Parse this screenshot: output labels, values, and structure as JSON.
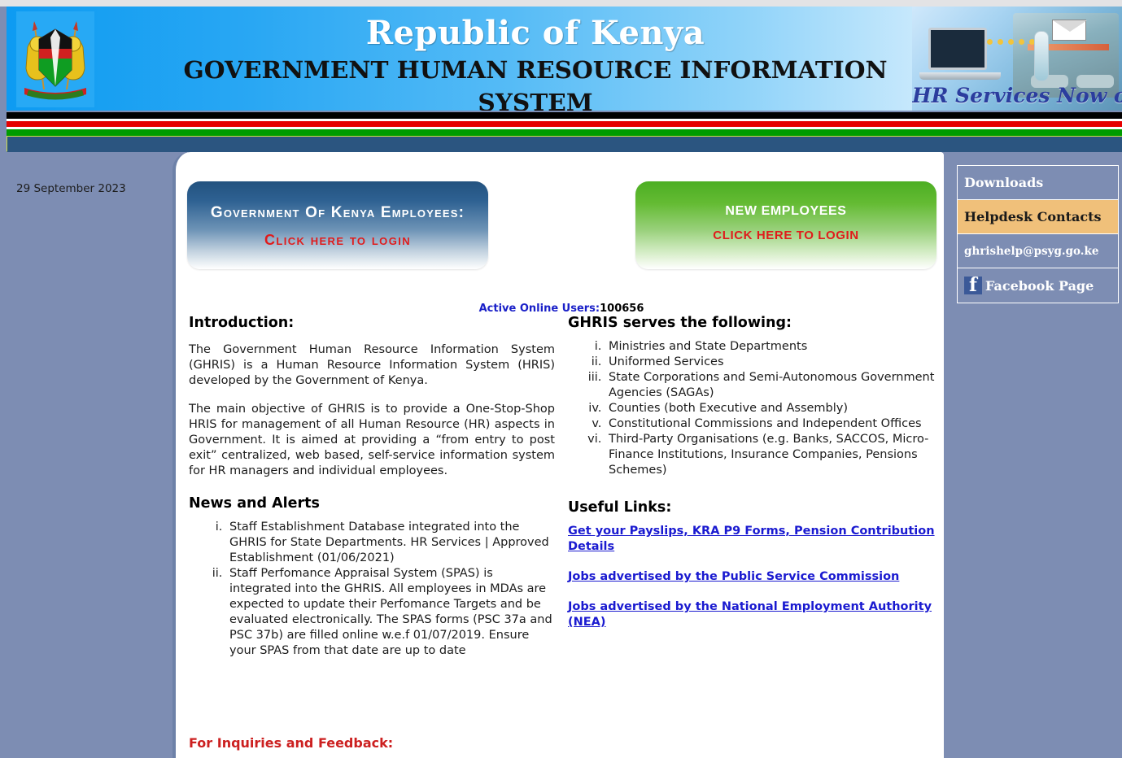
{
  "banner": {
    "emblem": "kenya-coat-of-arms",
    "title_line1": "Republic of Kenya",
    "title_line2": "GOVERNMENT HUMAN RESOURCE INFORMATION SYSTEM",
    "promo_caption": "HR Services Now online"
  },
  "date": "29 September 2023",
  "buttons": {
    "gok": {
      "line1": "Government Of Kenya Employees:",
      "line2": "Click here to login"
    },
    "new": {
      "line1": "NEW EMPLOYEES",
      "line2": "CLICK HERE TO LOGIN"
    }
  },
  "active_users": {
    "label": "Active Online Users:",
    "count": "100656"
  },
  "introduction": {
    "heading": "Introduction:",
    "paragraph1": "The Government Human Resource Information System (GHRIS) is a Human Resource Information System (HRIS) developed by the Government of Kenya.",
    "paragraph2": "The main objective of GHRIS is to provide a One-Stop-Shop HRIS for management of all Human Resource (HR) aspects in Government. It is aimed at providing a “from entry to post exit” centralized, web based, self-service information system for HR managers and individual employees."
  },
  "serves": {
    "heading": "GHRIS serves the following:",
    "items": [
      "Ministries and State Departments",
      "Uniformed Services",
      "State Corporations and Semi-Autonomous Government Agencies (SAGAs)",
      "Counties (both Executive and Assembly)",
      "Constitutional Commissions and Independent Offices",
      "Third-Party Organisations (e.g. Banks, SACCOS, Micro-Finance Institutions, Insurance Companies, Pensions Schemes)"
    ]
  },
  "news": {
    "heading": "News and Alerts",
    "items": [
      "Staff Establishment Database integrated into the GHRIS for State Departments. HR Services | Approved Establishment (01/06/2021)",
      "Staff Perfomance Appraisal System (SPAS) is integrated into the GHRIS. All employees in MDAs are expected to update their Perfomance Targets and be evaluated electronically. The SPAS forms (PSC 37a and PSC 37b) are filled online w.e.f 01/07/2019. Ensure your SPAS from that date are up to date"
    ]
  },
  "useful_links": {
    "heading": "Useful Links:",
    "links": [
      "Get your Payslips, KRA P9 Forms, Pension Contribution Details",
      "Jobs advertised by the Public Service Commission",
      "Jobs advertised by the National Employment Authority (NEA)"
    ]
  },
  "inquiries_heading": "For Inquiries and Feedback:",
  "sidebar": {
    "items": [
      {
        "label": "Downloads",
        "style": "plain"
      },
      {
        "label": "Helpdesk Contacts",
        "style": "highlight"
      },
      {
        "label": "ghrishelp@psyg.go.ke",
        "style": "small"
      },
      {
        "label": "Facebook Page",
        "style": "facebook",
        "icon": "facebook-icon"
      }
    ]
  },
  "colors": {
    "page_background": "#7d8db3",
    "navbar": "#2b5580",
    "flag_red": "#e60000",
    "flag_green": "#009c00",
    "flag_black": "#000000",
    "highlight_tan": "#f0c07a",
    "link_blue": "#1a1ad0",
    "inquiries_red": "#cc2020",
    "facebook_blue": "#3b5998"
  }
}
